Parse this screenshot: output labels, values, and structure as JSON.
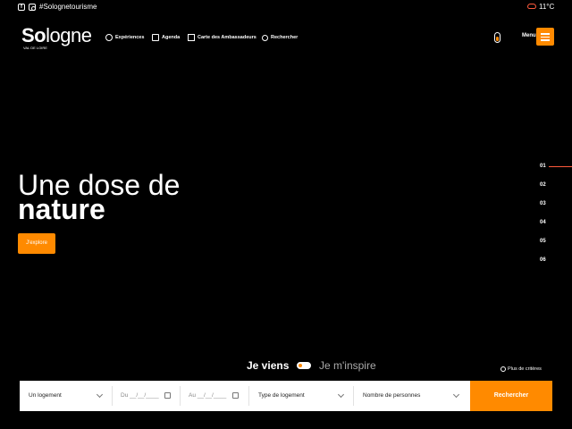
{
  "topbar": {
    "facebook_glyph": "f",
    "hashtag": "#Solognetourisme",
    "temperature": "11°C",
    "icons": [
      "facebook-icon",
      "instagram-icon",
      "cloud-icon"
    ]
  },
  "header": {
    "logo_bold": "So",
    "logo_rest": "logne",
    "logo_sub": "VAL DE LOIRE",
    "nav": [
      {
        "label": "Expériences",
        "icon": "lightbulb-icon"
      },
      {
        "label": "Agenda",
        "icon": "calendar-icon"
      },
      {
        "label": "Carte des Ambassadeurs",
        "icon": "map-icon"
      },
      {
        "label": "Rechercher",
        "icon": "search-icon"
      }
    ],
    "menu_label": "Menu"
  },
  "hero": {
    "line1": "Une dose de",
    "line2": "nature",
    "cta": "J'explore"
  },
  "slides": [
    "01",
    "02",
    "03",
    "04",
    "05",
    "06"
  ],
  "finder": {
    "mode_active": "Je viens",
    "mode_other": "Je m'inspire",
    "more_criteria": "Plus de critères",
    "fields": {
      "logement": "Un logement",
      "du_label": "Du",
      "du_value": "__/__/____",
      "au_label": "Au",
      "au_value": "__/__/____",
      "type": "Type de logement",
      "personnes": "Nombre de personnes"
    },
    "submit": "Rechercher"
  },
  "colors": {
    "accent": "#ff8a00",
    "slide_indicator": "#ff5a3c",
    "background": "#000000"
  }
}
